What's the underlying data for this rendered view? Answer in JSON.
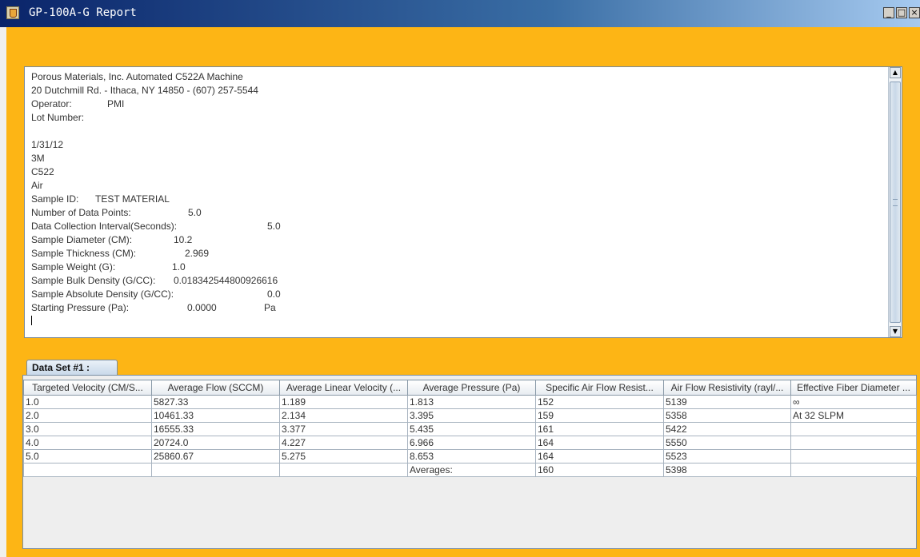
{
  "window": {
    "title": "GP-100A-G Report",
    "minimize_label": "_",
    "maximize_label": "□",
    "close_label": "×"
  },
  "report": {
    "lines": [
      {
        "label": "Porous Materials, Inc. Automated C522A Machine"
      },
      {
        "label": "20 Dutchmill Rd. - Ithaca, NY 14850 - (607) 257-5544"
      },
      {
        "label": "Operator:",
        "value": "PMI"
      },
      {
        "label": "Lot Number:"
      },
      {
        "label": ""
      },
      {
        "label": "1/31/12"
      },
      {
        "label": "3M"
      },
      {
        "label": "C522"
      },
      {
        "label": "Air"
      },
      {
        "label": "Sample ID:",
        "value": "TEST MATERIAL"
      },
      {
        "label": "Number of Data Points:",
        "value": "5.0"
      },
      {
        "label": "Data Collection Interval(Seconds):",
        "value": "5.0"
      },
      {
        "label": "Sample Diameter (CM):",
        "value": "10.2"
      },
      {
        "label": "Sample Thickness (CM):",
        "value": "2.969"
      },
      {
        "label": "Sample Weight (G):",
        "value": "1.0"
      },
      {
        "label": "Sample Bulk Density (G/CC):",
        "value": "0.018342544800926616"
      },
      {
        "label": "Sample Absolute Density (G/CC):",
        "value": "0.0"
      },
      {
        "label": "Starting Pressure (Pa):",
        "value": "0.0000",
        "unit": "Pa"
      }
    ]
  },
  "tab": {
    "label": "Data Set #1 :"
  },
  "table": {
    "headers": [
      "Targeted Velocity (CM/S...",
      "Average Flow (SCCM)",
      "Average Linear Velocity (...",
      "Average Pressure (Pa)",
      "Specific Air Flow Resist...",
      "Air Flow Resistivity (rayl/...",
      "Effective Fiber Diameter ..."
    ],
    "rows": [
      [
        "1.0",
        "5827.33",
        "1.189",
        "1.813",
        "152",
        "5139",
        "∞"
      ],
      [
        "2.0",
        "10461.33",
        "2.134",
        "3.395",
        "159",
        "5358",
        "At 32 SLPM"
      ],
      [
        "3.0",
        "16555.33",
        "3.377",
        "5.435",
        "161",
        "5422",
        ""
      ],
      [
        "4.0",
        "20724.0",
        "4.227",
        "6.966",
        "164",
        "5550",
        ""
      ],
      [
        "5.0",
        "25860.67",
        "5.275",
        "8.653",
        "164",
        "5523",
        ""
      ],
      [
        "",
        "",
        "",
        "Averages:",
        "160",
        "5398",
        ""
      ]
    ]
  },
  "colors": {
    "frame": "#fdb515",
    "titlebar_start": "#0a246a",
    "titlebar_end": "#a6caf0"
  },
  "icons": {
    "app": "java-cup-icon",
    "scroll_up": "chevron-up-icon",
    "scroll_down": "chevron-down-icon"
  }
}
